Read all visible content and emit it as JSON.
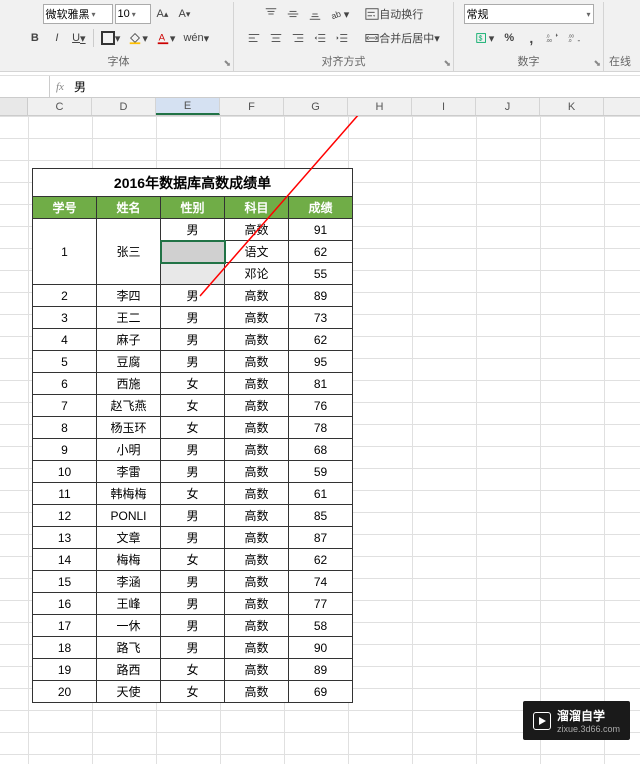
{
  "ribbon": {
    "font": {
      "family": "微软雅黑",
      "size": "10",
      "bold": "B",
      "italic": "I",
      "underline": "U",
      "wen": "wén",
      "group_label": "字体"
    },
    "align": {
      "wrap": "自动换行",
      "merge": "合并后居中",
      "group_label": "对齐方式"
    },
    "number": {
      "format": "常规",
      "percent": "%",
      "comma": ",",
      "inc_dec_a": ".0",
      "inc_dec_b": ".00",
      "group_label": "数字"
    },
    "style_label": "在线"
  },
  "formula": {
    "cell_ref": "",
    "fx": "fx",
    "value": "男"
  },
  "columns": [
    "C",
    "D",
    "E",
    "F",
    "G",
    "H",
    "I",
    "J",
    "K"
  ],
  "table": {
    "title": "2016年数据库高数成绩单",
    "headers": [
      "学号",
      "姓名",
      "性别",
      "科目",
      "成绩"
    ],
    "merged_rows": [
      {
        "id": "1",
        "name": "张三",
        "details": [
          {
            "sex": "男",
            "subject": "高数",
            "score": "91"
          },
          {
            "sex": "",
            "subject": "语文",
            "score": "62"
          },
          {
            "sex": "",
            "subject": "邓论",
            "score": "55"
          }
        ]
      }
    ],
    "rows": [
      {
        "id": "2",
        "name": "李四",
        "sex": "男",
        "subject": "高数",
        "score": "89"
      },
      {
        "id": "3",
        "name": "王二",
        "sex": "男",
        "subject": "高数",
        "score": "73"
      },
      {
        "id": "4",
        "name": "麻子",
        "sex": "男",
        "subject": "高数",
        "score": "62"
      },
      {
        "id": "5",
        "name": "豆腐",
        "sex": "男",
        "subject": "高数",
        "score": "95"
      },
      {
        "id": "6",
        "name": "西施",
        "sex": "女",
        "subject": "高数",
        "score": "81"
      },
      {
        "id": "7",
        "name": "赵飞燕",
        "sex": "女",
        "subject": "高数",
        "score": "76"
      },
      {
        "id": "8",
        "name": "杨玉环",
        "sex": "女",
        "subject": "高数",
        "score": "78"
      },
      {
        "id": "9",
        "name": "小明",
        "sex": "男",
        "subject": "高数",
        "score": "68"
      },
      {
        "id": "10",
        "name": "李雷",
        "sex": "男",
        "subject": "高数",
        "score": "59"
      },
      {
        "id": "11",
        "name": "韩梅梅",
        "sex": "女",
        "subject": "高数",
        "score": "61"
      },
      {
        "id": "12",
        "name": "PONLI",
        "sex": "男",
        "subject": "高数",
        "score": "85"
      },
      {
        "id": "13",
        "name": "文章",
        "sex": "男",
        "subject": "高数",
        "score": "87"
      },
      {
        "id": "14",
        "name": "梅梅",
        "sex": "女",
        "subject": "高数",
        "score": "62"
      },
      {
        "id": "15",
        "name": "李涵",
        "sex": "男",
        "subject": "高数",
        "score": "74"
      },
      {
        "id": "16",
        "name": "王峰",
        "sex": "男",
        "subject": "高数",
        "score": "77"
      },
      {
        "id": "17",
        "name": "一休",
        "sex": "男",
        "subject": "高数",
        "score": "58"
      },
      {
        "id": "18",
        "name": "路飞",
        "sex": "男",
        "subject": "高数",
        "score": "90"
      },
      {
        "id": "19",
        "name": "路西",
        "sex": "女",
        "subject": "高数",
        "score": "89"
      },
      {
        "id": "20",
        "name": "天使",
        "sex": "女",
        "subject": "高数",
        "score": "69"
      }
    ]
  },
  "chart_data": {
    "type": "table",
    "title": "2016年数据库高数成绩单",
    "columns": [
      "学号",
      "姓名",
      "性别",
      "科目",
      "成绩"
    ],
    "rows": [
      [
        "1",
        "张三",
        "男",
        "高数",
        91
      ],
      [
        "1",
        "张三",
        "",
        "语文",
        62
      ],
      [
        "1",
        "张三",
        "",
        "邓论",
        55
      ],
      [
        "2",
        "李四",
        "男",
        "高数",
        89
      ],
      [
        "3",
        "王二",
        "男",
        "高数",
        73
      ],
      [
        "4",
        "麻子",
        "男",
        "高数",
        62
      ],
      [
        "5",
        "豆腐",
        "男",
        "高数",
        95
      ],
      [
        "6",
        "西施",
        "女",
        "高数",
        81
      ],
      [
        "7",
        "赵飞燕",
        "女",
        "高数",
        76
      ],
      [
        "8",
        "杨玉环",
        "女",
        "高数",
        78
      ],
      [
        "9",
        "小明",
        "男",
        "高数",
        68
      ],
      [
        "10",
        "李雷",
        "男",
        "高数",
        59
      ],
      [
        "11",
        "韩梅梅",
        "女",
        "高数",
        61
      ],
      [
        "12",
        "PONLI",
        "男",
        "高数",
        85
      ],
      [
        "13",
        "文章",
        "男",
        "高数",
        87
      ],
      [
        "14",
        "梅梅",
        "女",
        "高数",
        62
      ],
      [
        "15",
        "李涵",
        "男",
        "高数",
        74
      ],
      [
        "16",
        "王峰",
        "男",
        "高数",
        77
      ],
      [
        "17",
        "一休",
        "男",
        "高数",
        58
      ],
      [
        "18",
        "路飞",
        "男",
        "高数",
        90
      ],
      [
        "19",
        "路西",
        "女",
        "高数",
        89
      ],
      [
        "20",
        "天使",
        "女",
        "高数",
        69
      ]
    ]
  },
  "watermark": {
    "brand": "溜溜自学",
    "url": "zixue.3d66.com"
  }
}
